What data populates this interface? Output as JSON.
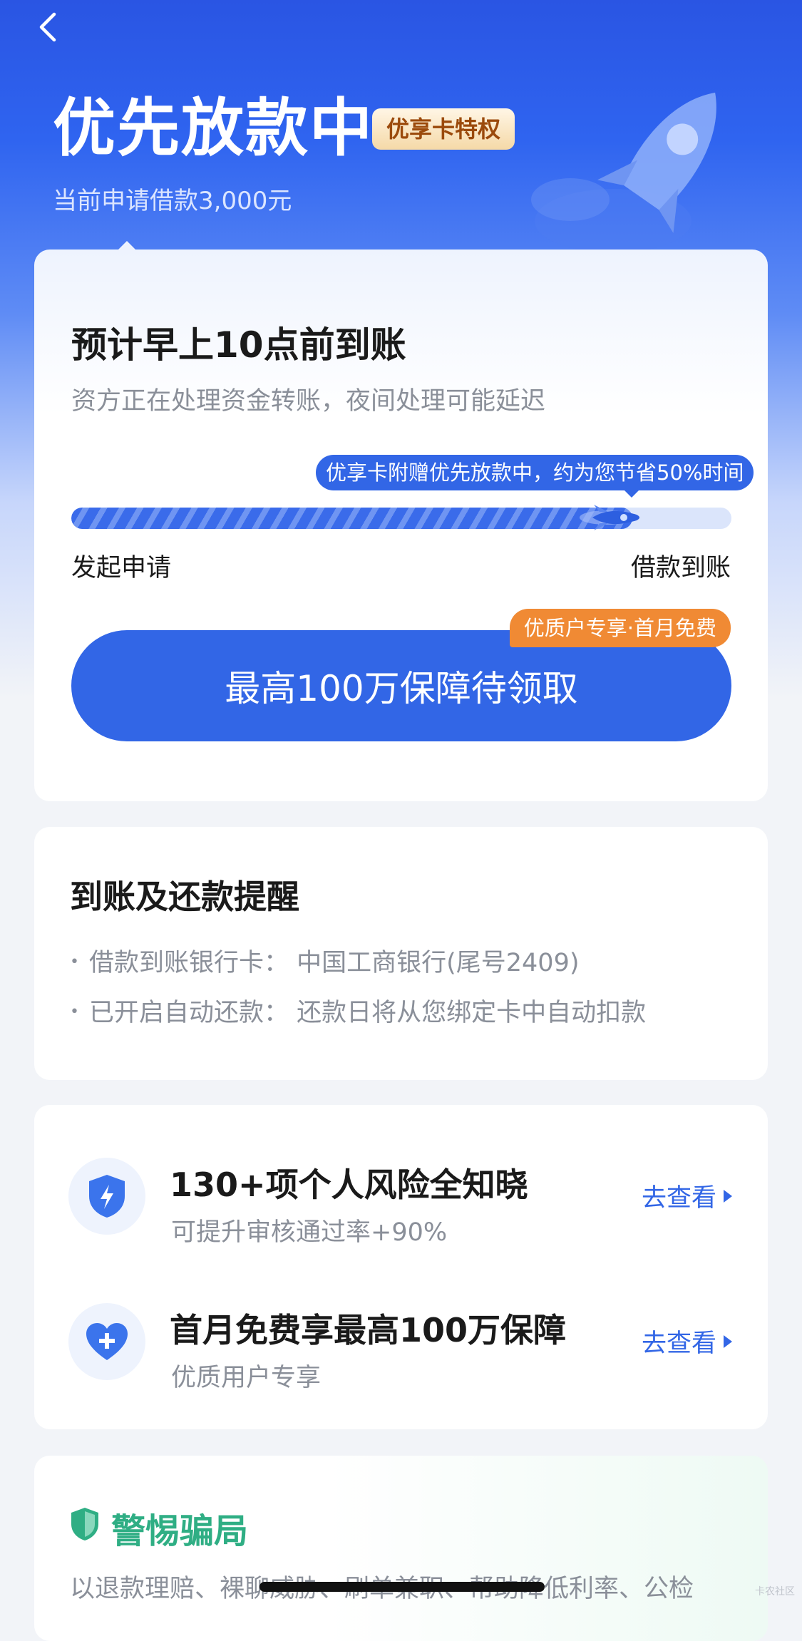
{
  "header": {
    "title": "优先放款中",
    "badge": "优享卡特权",
    "subtitle": "当前申请借款3,000元"
  },
  "status_card": {
    "eta": "预计早上10点前到账",
    "note": "资方正在处理资金转账，夜间处理可能延迟",
    "tip": "优享卡附赠优先放款中，约为您节省50%时间",
    "progress": 0.85,
    "step_start": "发起申请",
    "step_end": "借款到账",
    "cta_label": "最高100万保障待领取",
    "cta_tag": "优质户专享·首月免费"
  },
  "reminder": {
    "title": "到账及还款提醒",
    "items": [
      "借款到账银行卡：  中国工商银行(尾号2409)",
      "已开启自动还款：  还款日将从您绑定卡中自动扣款"
    ]
  },
  "services": [
    {
      "icon": "shield-lightning-icon",
      "title": "130+项个人风险全知晓",
      "subtitle": "可提升审核通过率+90%",
      "link": "去查看"
    },
    {
      "icon": "heart-plus-icon",
      "title": "首月免费享最高100万保障",
      "subtitle": "优质用户专享",
      "link": "去查看"
    }
  ],
  "scam": {
    "title": "警惕骗局",
    "text": "以退款理赔、裸聊威胁、刷单兼职、帮助降低利率、公检"
  },
  "watermark": "卡农社区",
  "colors": {
    "primary": "#3266e6",
    "accent_orange": "#f08a34",
    "scam_green": "#2fae84"
  }
}
